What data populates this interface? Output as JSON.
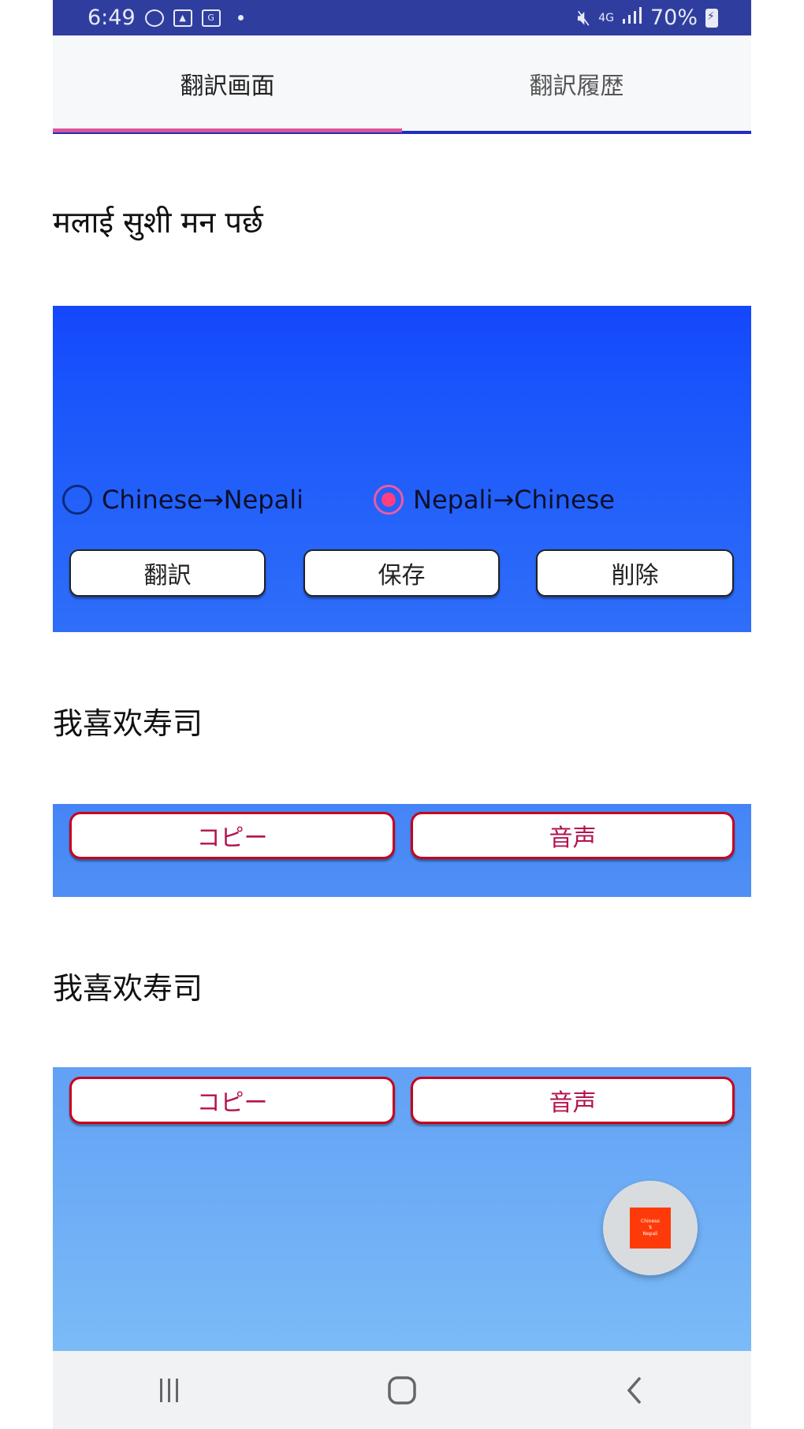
{
  "status_bar": {
    "time": "6:49",
    "left_icons": [
      "vpn-globe-icon",
      "image-icon",
      "gmail-icon",
      "dot-icon"
    ],
    "right_icons": [
      "vibrate-mute-icon",
      "network-4g-icon",
      "signal-icon",
      "battery-charging-icon"
    ],
    "network_label": "4G",
    "battery": "70%"
  },
  "tabs": [
    {
      "label": "翻訳画面",
      "active": true
    },
    {
      "label": "翻訳履歴",
      "active": false
    }
  ],
  "source": {
    "text": "मलाई सुशी मन पर्छ"
  },
  "direction": {
    "options": [
      {
        "label": "Chinese→Nepali",
        "checked": false
      },
      {
        "label": "Nepali→Chinese",
        "checked": true
      }
    ]
  },
  "actions": {
    "translate_label": "翻訳",
    "save_label": "保存",
    "delete_label": "削除"
  },
  "results": [
    {
      "text": "我喜欢寿司",
      "copy_label": "コピー",
      "speak_label": "音声"
    },
    {
      "text": "我喜欢寿司",
      "copy_label": "コピー",
      "speak_label": "音声"
    }
  ],
  "fab": {
    "badge_lines": [
      "Chinese",
      "⇅",
      "Nepali"
    ]
  },
  "colors": {
    "status_bar": "#2f3e9e",
    "tab_indicator": "#d9559a",
    "tab_underline": "#1f2fbf",
    "gradient_top": "#1447fb",
    "gradient_bottom": "#7bbbf7",
    "radio_checked": "#ff3f7f",
    "red_button_border": "#c7001b",
    "fab_badge": "#ff3a0a"
  }
}
